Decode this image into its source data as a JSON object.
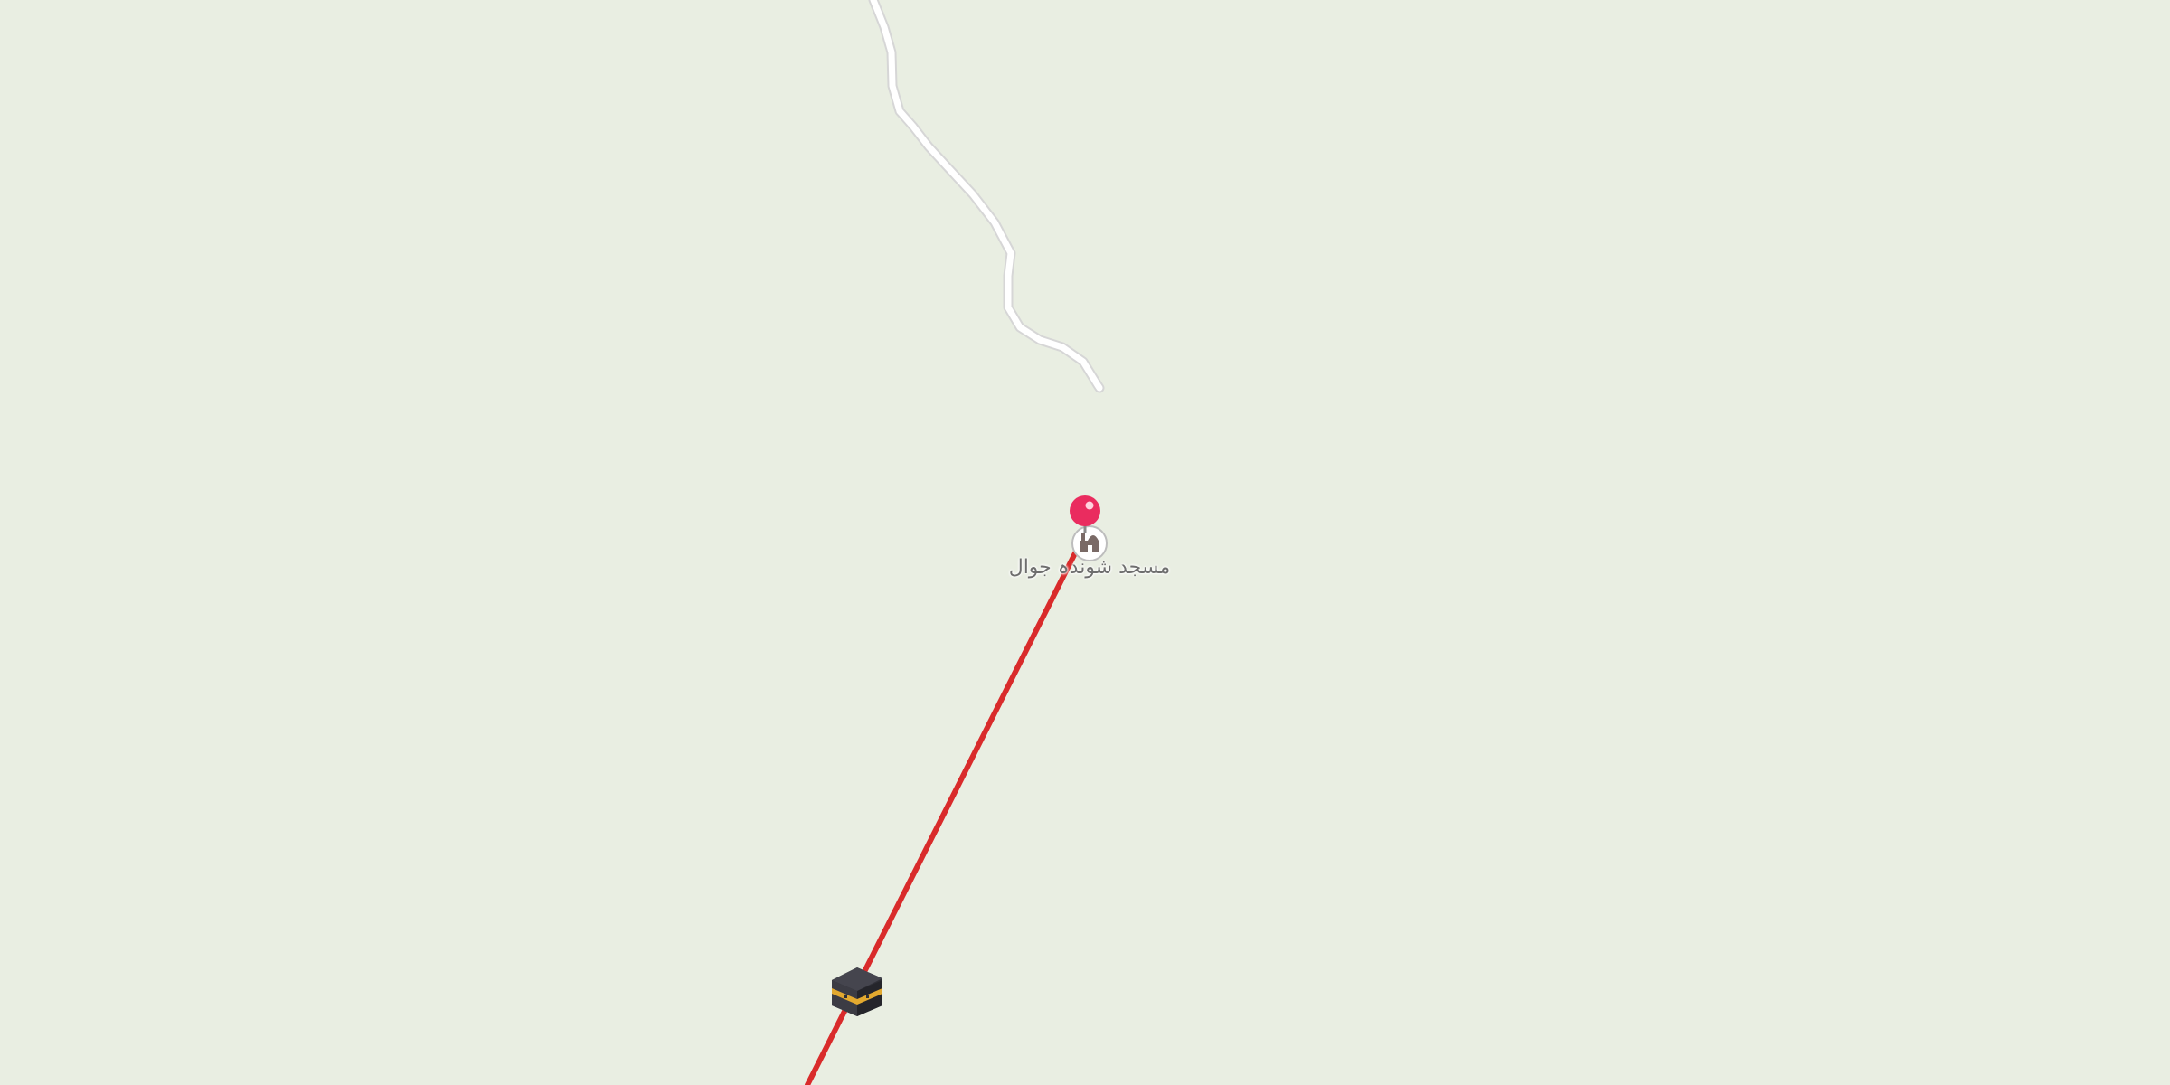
{
  "map": {
    "background_color": "#e9eee2",
    "road_color": "#ffffff",
    "road_casing_color": "#d8d8d8",
    "qibla_line_color": "#d92b2b",
    "pin_color": "#ea2c5f"
  },
  "poi": {
    "label": "مسجد شوندہ جوال",
    "icon": "mosque-icon"
  },
  "pin": {
    "icon": "location-pin-icon"
  },
  "kaaba": {
    "icon": "kaaba-icon"
  }
}
